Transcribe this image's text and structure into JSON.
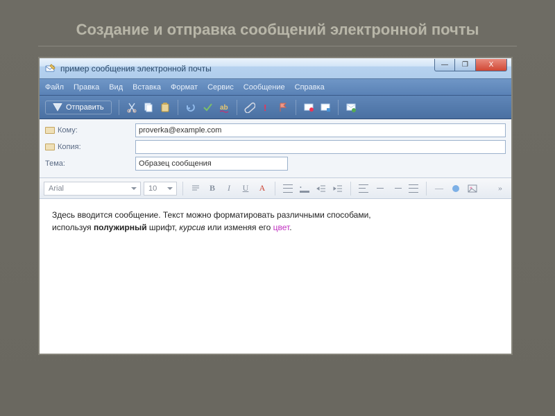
{
  "slide": {
    "title": "Создание и отправка сообщений электронной почты"
  },
  "window": {
    "title": "пример сообщения электронной почты",
    "controls": {
      "min": "—",
      "max": "❐",
      "close": "X"
    }
  },
  "menu": {
    "file": "Файл",
    "edit": "Правка",
    "view": "Вид",
    "insert": "Вставка",
    "format": "Формат",
    "service": "Сервис",
    "message": "Сообщение",
    "help": "Справка"
  },
  "toolbar": {
    "send": "Отправить"
  },
  "headers": {
    "to_label": "Кому:",
    "to_value": "proverka@example.com",
    "cc_label": "Копия:",
    "cc_value": "",
    "subject_label": "Тема:",
    "subject_value": "Образец сообщения"
  },
  "format_toolbar": {
    "font": "Arial",
    "size": "10",
    "bold_glyph": "B",
    "italic_glyph": "I",
    "underline_glyph": "U",
    "color_glyph": "A"
  },
  "body": {
    "line1": "Здесь вводится сообщение. Текст можно форматировать различными способами,",
    "line2a": "используя ",
    "bold_word": "полужирный",
    "line2b": " шрифт, ",
    "italic_word": "курсив",
    "line2c": " или изменяя его ",
    "colored_word": "цвет",
    "period": "."
  }
}
